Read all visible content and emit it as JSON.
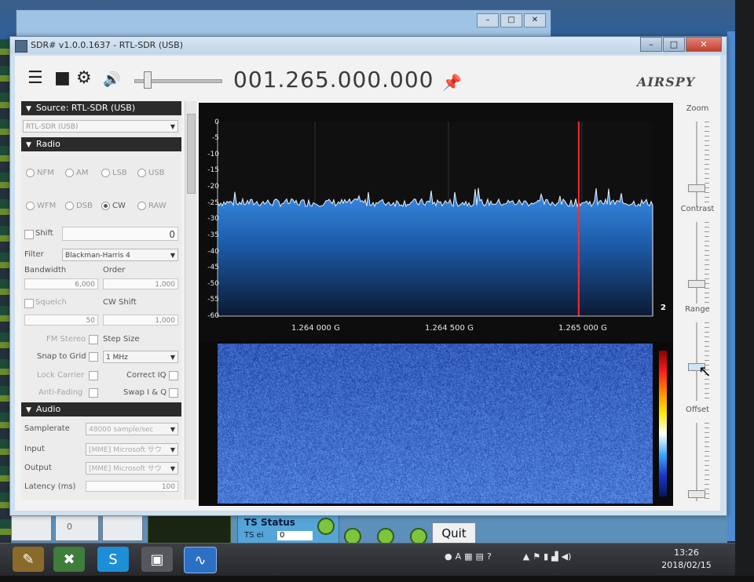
{
  "window": {
    "title": "SDR# v1.0.0.1637 - RTL-SDR (USB)",
    "controls": [
      "–",
      "□",
      "✕"
    ]
  },
  "toolbar": {
    "frequency": "001.265.000.000",
    "logo": "AIRSPY"
  },
  "source": {
    "header": "Source: RTL-SDR (USB)",
    "device": "RTL-SDR (USB)"
  },
  "radio": {
    "header": "Radio",
    "modes": [
      "NFM",
      "AM",
      "LSB",
      "USB",
      "WFM",
      "DSB",
      "CW",
      "RAW"
    ],
    "selected_mode": "CW",
    "shift_label": "Shift",
    "shift_value": "0",
    "filter_label": "Filter",
    "filter_value": "Blackman-Harris 4",
    "bandwidth_label": "Bandwidth",
    "bandwidth_value": "6,000",
    "order_label": "Order",
    "order_value": "1,000",
    "squelch_label": "Squelch",
    "squelch_value": "50",
    "cw_shift_label": "CW Shift",
    "cw_shift_value": "1,000",
    "fm_stereo_label": "FM Stereo",
    "step_size_label": "Step Size",
    "snap_label": "Snap to Grid",
    "step_value": "1 MHz",
    "lock_carrier_label": "Lock Carrier",
    "correct_iq_label": "Correct IQ",
    "anti_fading_label": "Anti-Fading",
    "swap_iq_label": "Swap I & Q"
  },
  "audio": {
    "header": "Audio",
    "samplerate_label": "Samplerate",
    "samplerate_value": "48000 sample/sec",
    "input_label": "Input",
    "input_value": "[MME] Microsoft サウ",
    "output_label": "Output",
    "output_value": "[MME] Microsoft サウ",
    "latency_label": "Latency (ms)",
    "latency_value": "100"
  },
  "spectrum": {
    "y_labels": [
      "0",
      "-5",
      "-10",
      "-15",
      "-20",
      "-25",
      "-30",
      "-35",
      "-40",
      "-45",
      "-50",
      "-55",
      "-60"
    ],
    "x_labels": [
      "1.264 000 G",
      "1.264 500 G",
      "1.265 000 G"
    ],
    "badge": "2",
    "marker_position": 0.83,
    "noise_floor_db": -25
  },
  "right_panel": {
    "zoom_label": "Zoom",
    "contrast_label": "Contrast",
    "range_label": "Range",
    "offset_label": "Offset"
  },
  "background_app": {
    "ts_status": "TS Status",
    "ts_label": "TS ei",
    "ts_value": "0",
    "quit_label": "Quit",
    "counter": "0"
  },
  "taskbar": {
    "time": "13:26",
    "date": "2018/02/15"
  },
  "colors": {
    "marker": "#ff2a2a",
    "spectrum_fill": "#2f7fd6",
    "panel_header": "#2b2b2b"
  }
}
